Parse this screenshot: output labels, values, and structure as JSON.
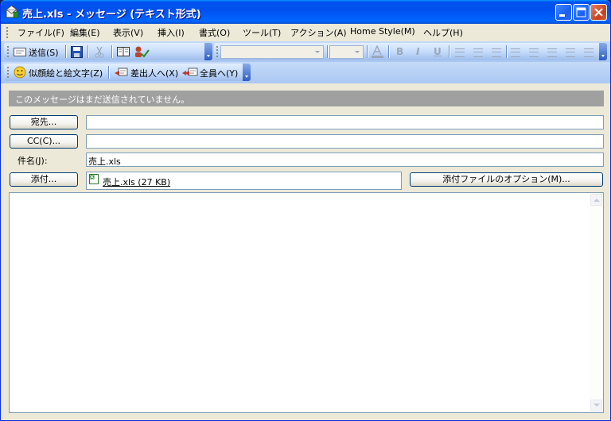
{
  "window": {
    "title": "売上.xls - メッセージ (テキスト形式)",
    "buttons": {
      "minimize": "_",
      "maximize": "□",
      "close": "×"
    }
  },
  "menubar": {
    "items": [
      "ファイル(F)",
      "編集(E)",
      "表示(V)",
      "挿入(I)",
      "書式(O)",
      "ツール(T)",
      "アクション(A)",
      "Home Style(M)",
      "ヘルプ(H)"
    ]
  },
  "toolbar_standard": {
    "send": "送信(S)"
  },
  "toolbar_format": {
    "font_name": "",
    "font_size": "",
    "bold": "B",
    "italic": "I",
    "underline": "U"
  },
  "toolbar_misc": {
    "emoticon": "似顔絵と絵文字(Z)",
    "reply_sender": "差出人へ(X)",
    "reply_all": "全員へ(Y)"
  },
  "info_bar": {
    "text": "このメッセージはまだ送信されていません。"
  },
  "form": {
    "to_button": "宛先...",
    "to_value": "",
    "cc_button": "CC(C)...",
    "cc_value": "",
    "subject_label": "件名(J):",
    "subject_value": "売上.xls",
    "attach_button": "添付...",
    "attachment": "売上.xls (27 KB)",
    "attach_options_button": "添付ファイルのオプション(M)..."
  },
  "body": {
    "text": ""
  },
  "colors": {
    "titlebar": "#0053ee",
    "toolbar": "#c4daf8",
    "info_bar": "#a0a0a0"
  }
}
